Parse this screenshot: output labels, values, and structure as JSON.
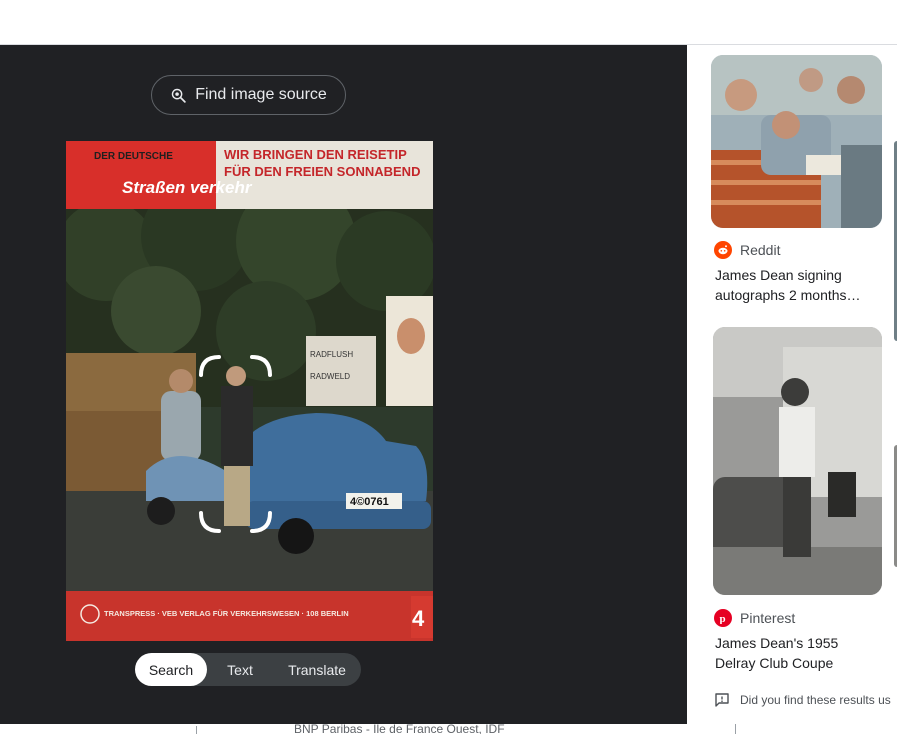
{
  "find_source": {
    "label": "Find image source",
    "icon": "lens-search-icon"
  },
  "magazine": {
    "brand_line1": "DER DEUTSCHE",
    "brand_logo": "Straßen verkehr",
    "headline_line1": "WIR BRINGEN DEN REISETIP",
    "headline_line2": "FÜR DEN FREIEN SONNABEND",
    "footer": "TRANSPRESS · VEB VERLAG FÜR VERKEHRSWESEN · 108 BERLIN",
    "issue": "4",
    "plate": "4©0761",
    "sign1": "RADFLUSH",
    "sign2": "RADWELD"
  },
  "modes": [
    "Search",
    "Text",
    "Translate"
  ],
  "active_mode": "Search",
  "bottom_text": "BNP Paribas  -  Ile de France Ouest, IDF",
  "results": [
    {
      "source": "Reddit",
      "source_icon": "reddit-icon",
      "title_lines": [
        "James Dean signing",
        "autographs 2 months…"
      ]
    },
    {
      "source": "Pinterest",
      "source_icon": "pinterest-icon",
      "title_lines": [
        "James Dean's 1955",
        "Delray Club Coupe"
      ]
    }
  ],
  "feedback": {
    "text": "Did you find these results us",
    "icon": "feedback-icon"
  },
  "colors": {
    "dark_bg": "#202124",
    "reddit": "#ff4500",
    "pinterest": "#e60023"
  }
}
